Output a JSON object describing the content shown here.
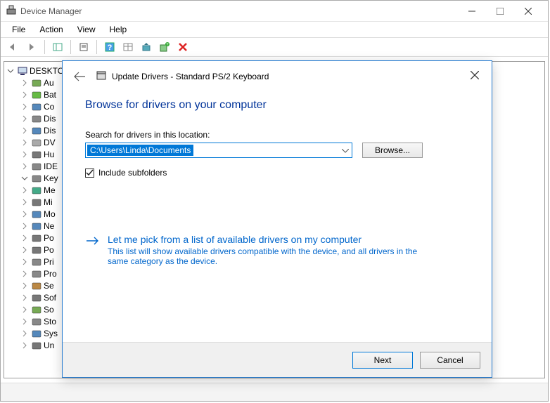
{
  "window": {
    "title": "Device Manager"
  },
  "menu": {
    "file": "File",
    "action": "Action",
    "view": "View",
    "help": "Help"
  },
  "tree": {
    "root": "DESKTO",
    "items": [
      {
        "label": "Au",
        "icon": "sound"
      },
      {
        "label": "Bat",
        "icon": "battery"
      },
      {
        "label": "Co",
        "icon": "monitor"
      },
      {
        "label": "Dis",
        "icon": "disk"
      },
      {
        "label": "Dis",
        "icon": "display"
      },
      {
        "label": "DV",
        "icon": "dvd"
      },
      {
        "label": "Hu",
        "icon": "usb"
      },
      {
        "label": "IDE",
        "icon": "ide"
      },
      {
        "label": "Key",
        "icon": "keyboard",
        "expanded": true
      },
      {
        "label": "Me",
        "icon": "memory"
      },
      {
        "label": "Mi",
        "icon": "mouse"
      },
      {
        "label": "Mo",
        "icon": "monitor"
      },
      {
        "label": "Ne",
        "icon": "network"
      },
      {
        "label": "Po",
        "icon": "port"
      },
      {
        "label": "Po",
        "icon": "port"
      },
      {
        "label": "Pri",
        "icon": "printer"
      },
      {
        "label": "Pro",
        "icon": "cpu"
      },
      {
        "label": "Se",
        "icon": "sensor"
      },
      {
        "label": "Sof",
        "icon": "software"
      },
      {
        "label": "So",
        "icon": "sound"
      },
      {
        "label": "Sto",
        "icon": "storage"
      },
      {
        "label": "Sys",
        "icon": "system"
      },
      {
        "label": "Un",
        "icon": "usb"
      }
    ]
  },
  "dialog": {
    "title": "Update Drivers - Standard PS/2 Keyboard",
    "heading": "Browse for drivers on your computer",
    "search_label": "Search for drivers in this location:",
    "path_value": "C:\\Users\\Linda\\Documents",
    "browse": "Browse...",
    "include_subfolders": "Include subfolders",
    "option_title": "Let me pick from a list of available drivers on my computer",
    "option_desc": "This list will show available drivers compatible with the device, and all drivers in the same category as the device.",
    "next": "Next",
    "cancel": "Cancel"
  }
}
